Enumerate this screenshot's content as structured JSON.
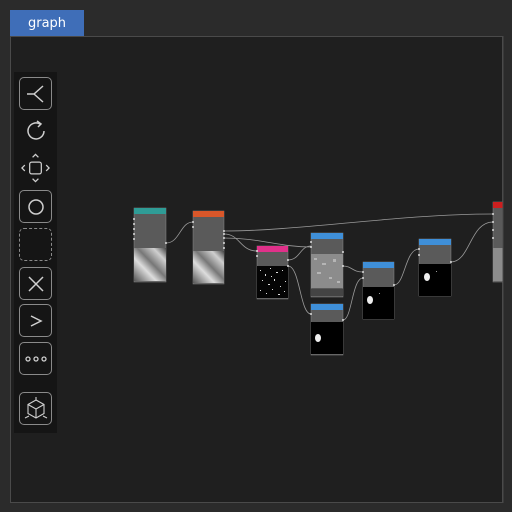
{
  "tabs": [
    {
      "label": "graph",
      "active": true
    }
  ],
  "toolbar": {
    "tools": [
      {
        "icon": "branch-icon"
      },
      {
        "icon": "refresh-icon"
      },
      {
        "icon": "move-icon"
      },
      {
        "icon": "circle-icon"
      },
      {
        "icon": "dashed-selection-icon"
      },
      {
        "icon": "close-icon"
      },
      {
        "icon": "chevron-right-icon"
      },
      {
        "icon": "more-dots-icon"
      },
      {
        "icon": "cube-view-icon"
      }
    ]
  },
  "colors": {
    "tab_active": "#3f6eb8",
    "node_header_teal": "#2f9c96",
    "node_header_orange": "#d9572a",
    "node_header_pink": "#e0318a",
    "node_header_blue": "#3f8fd8",
    "node_header_red": "#cc1f1f",
    "node_body": "#5a5a5a",
    "wire": "#9a9a9a"
  },
  "nodes": [
    {
      "id": "n1",
      "header_color": "#2f9c96",
      "preview": "gradient-noise"
    },
    {
      "id": "n2",
      "header_color": "#d9572a",
      "preview": "gradient-noise"
    },
    {
      "id": "n3",
      "header_color": "#e0318a",
      "preview": "speckle"
    },
    {
      "id": "n4",
      "header_color": "#3f8fd8",
      "preview": "grey-texture"
    },
    {
      "id": "n5",
      "header_color": "#3f8fd8",
      "preview": "blob"
    },
    {
      "id": "n6",
      "header_color": "#3f8fd8",
      "preview": "blob"
    },
    {
      "id": "n7",
      "header_color": "#3f8fd8",
      "preview": "blob"
    },
    {
      "id": "n8",
      "header_color": "#cc1f1f",
      "preview": "grey-texture"
    }
  ]
}
